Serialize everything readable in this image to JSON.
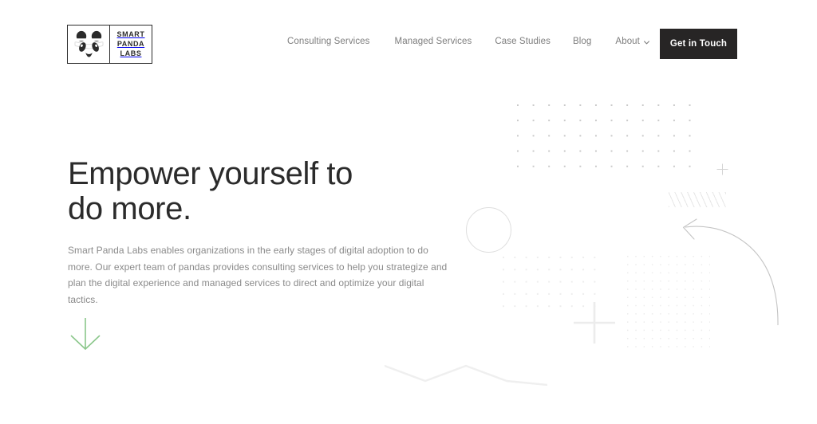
{
  "site": {
    "brand_name": "Smart Panda Labs",
    "accent_color": "#8bc78b",
    "cta_background": "#272525",
    "heading_color": "#2b2b2b",
    "body_text_color": "#8a8a8a",
    "nav_text_color": "#7d7d7d",
    "background_color": "#ffffff"
  },
  "header": {
    "logo": {
      "icon_name": "panda-face-logo-icon",
      "line1": "SMART",
      "line2": "PANDA",
      "line3": "LABS"
    },
    "nav_items": [
      {
        "label": "Consulting Services",
        "has_dropdown": false
      },
      {
        "label": "Managed Services",
        "has_dropdown": false
      },
      {
        "label": "Case Studies",
        "has_dropdown": false
      },
      {
        "label": "Blog",
        "has_dropdown": false
      },
      {
        "label": "About",
        "has_dropdown": true
      }
    ],
    "cta_button": {
      "label": "Get in Touch"
    }
  },
  "hero": {
    "title_line_1": "Empower yourself to",
    "title_line_2": "do more.",
    "body": "Smart Panda Labs enables organizations in the early stages of digital adoption to do more. Our expert team of pandas provides consulting services to help you strategize and plan the digital experience and managed services to direct and optimize your digital tactics.",
    "scroll_indicator_icon": "arrow-down-icon"
  },
  "decorations": [
    {
      "name": "dot-grid-top-right",
      "columns": 12,
      "rows": 5,
      "color": "#c9c9c9"
    },
    {
      "name": "dot-grid-middle",
      "columns": 9,
      "rows": 5,
      "color": "#ededed"
    },
    {
      "name": "dot-grid-right",
      "columns": 11,
      "rows": 12,
      "color": "#ebebeb"
    },
    {
      "name": "diagonal-hatch-lines",
      "color": "#e6e6e6"
    },
    {
      "name": "circle-outline",
      "color": "#dedede"
    },
    {
      "name": "plus-small",
      "color": "#d8d8d8"
    },
    {
      "name": "plus-large",
      "color": "#ebebeb"
    },
    {
      "name": "curved-arrow",
      "color": "#c4c4c4"
    },
    {
      "name": "zigzag-line",
      "color": "#efefef"
    }
  ]
}
